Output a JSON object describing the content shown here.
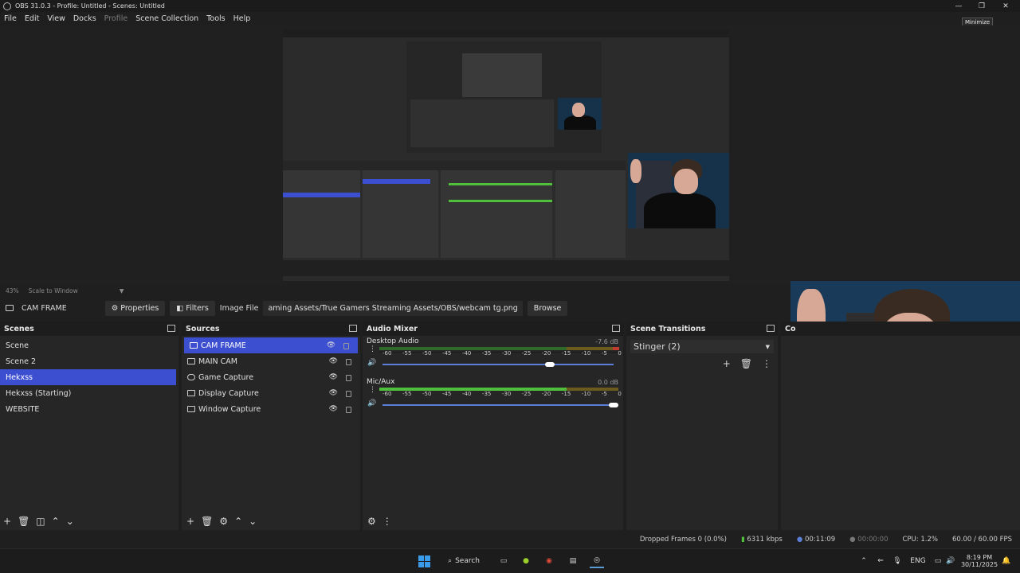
{
  "window": {
    "title": "OBS 31.0.3 - Profile: Untitled - Scenes: Untitled",
    "tooltip": "Minimize"
  },
  "menu": [
    {
      "label": "File"
    },
    {
      "label": "Edit"
    },
    {
      "label": "View"
    },
    {
      "label": "Docks"
    },
    {
      "label": "Profile",
      "disabled": true
    },
    {
      "label": "Scene Collection"
    },
    {
      "label": "Tools"
    },
    {
      "label": "Help"
    }
  ],
  "preview": {
    "zoom": "43%",
    "scale_mode": "Scale to Window"
  },
  "context_bar": {
    "source": "CAM FRAME",
    "properties": "Properties",
    "filters": "Filters",
    "image_file_label": "Image File",
    "image_path": "aming Assets/True Gamers Streaming Assets/OBS/webcam tg.png",
    "browse": "Browse"
  },
  "scenes": {
    "title": "Scenes",
    "items": [
      "Scene",
      "Scene 2",
      "Hekxss",
      "Hekxss (Starting)",
      "WEBSITE"
    ],
    "selected": "Hekxss"
  },
  "sources": {
    "title": "Sources",
    "items": [
      {
        "label": "CAM FRAME",
        "icon": "image-icon"
      },
      {
        "label": "MAIN CAM",
        "icon": "camera-icon"
      },
      {
        "label": "Game Capture",
        "icon": "gamepad-icon"
      },
      {
        "label": "Display Capture",
        "icon": "monitor-icon"
      },
      {
        "label": "Window Capture",
        "icon": "window-icon"
      }
    ],
    "selected": "CAM FRAME"
  },
  "audio_mixer": {
    "title": "Audio Mixer",
    "ticks": [
      "-60",
      "-55",
      "-50",
      "-45",
      "-40",
      "-35",
      "-30",
      "-25",
      "-20",
      "-15",
      "-10",
      "-5",
      "0"
    ],
    "channels": [
      {
        "name": "Desktop Audio",
        "db": "-7.6 dB",
        "volume": 0.72
      },
      {
        "name": "Mic/Aux",
        "db": "0.0 dB",
        "volume": 1.0
      }
    ]
  },
  "scene_transitions": {
    "title": "Scene Transitions",
    "selected": "Stinger (2)"
  },
  "controls": {
    "title": "Co"
  },
  "status": {
    "dropped_frames": "Dropped Frames 0 (0.0%)",
    "bitrate": "6311 kbps",
    "stream_time": "00:11:09",
    "record_time": "00:00:00",
    "cpu": "CPU: 1.2%",
    "fps": "60.00 / 60.00 FPS"
  },
  "taskbar": {
    "search": "Search",
    "lang": "ENG",
    "time": "8:19 PM",
    "date": "30/11/2025"
  },
  "colors": {
    "accent": "#3d4fd1",
    "meter_green": "#4fbf3c",
    "meter_yellow": "#b8a12f",
    "meter_red": "#c23b30"
  }
}
